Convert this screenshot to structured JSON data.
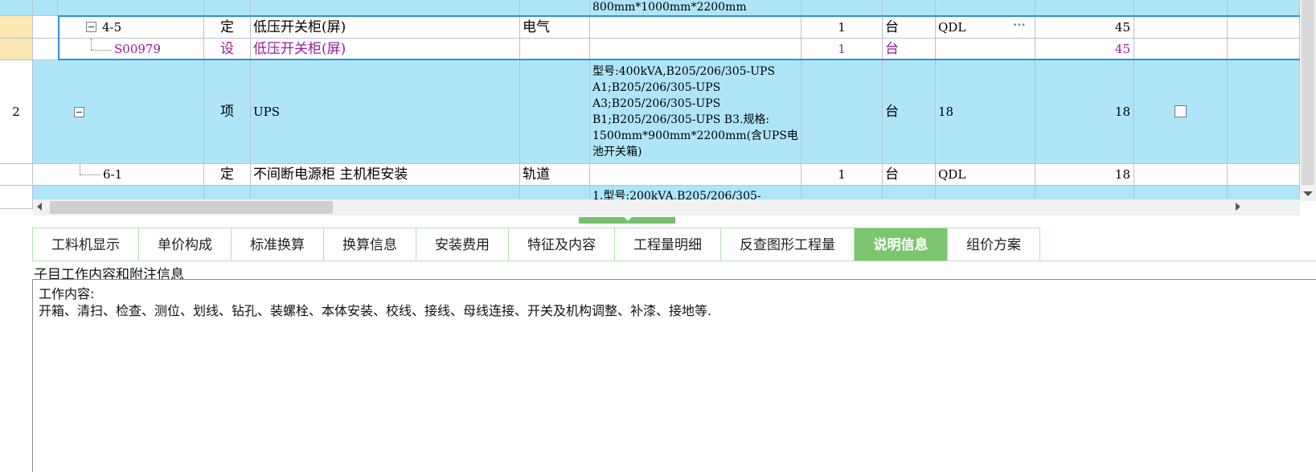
{
  "grid": {
    "row0": {
      "spec": "800mm*1000mm*2200mm"
    },
    "row1": {
      "code": "4-5",
      "type": "定",
      "name": "低压开关柜(屏)",
      "specialty": "电气",
      "qty": "1",
      "unit": "台",
      "calc": "QDL",
      "more": "···",
      "total": "45"
    },
    "row2": {
      "code": "S00979",
      "type": "设",
      "name": "低压开关柜(屏)",
      "qty": "1",
      "unit": "台",
      "total": "45"
    },
    "row3": {
      "rownum": "2",
      "type": "项",
      "name": "UPS",
      "spec_lines": [
        "型号:400kVA,B205/206/305-UPS",
        "A1;B205/206/305-UPS",
        "A3;B205/206/305-UPS",
        "B1;B205/206/305-UPS B3.规格:",
        "1500mm*900mm*2200mm(含UPS电",
        "池开关箱)"
      ],
      "unit": "台",
      "calc": "18",
      "total": "18"
    },
    "row4": {
      "code": "6-1",
      "type": "定",
      "name": "不间断电源柜 主机柜安装",
      "specialty": "轨道",
      "qty": "1",
      "unit": "台",
      "calc": "QDL",
      "total": "18"
    },
    "row5": {
      "spec": "1.型号:200kVA,B205/206/305-"
    }
  },
  "tabs": [
    {
      "label": "工料机显示"
    },
    {
      "label": "单价构成"
    },
    {
      "label": "标准换算"
    },
    {
      "label": "换算信息"
    },
    {
      "label": "安装费用"
    },
    {
      "label": "特征及内容"
    },
    {
      "label": "工程量明细"
    },
    {
      "label": "反查图形工程量"
    },
    {
      "label": "说明信息",
      "active": true
    },
    {
      "label": "组价方案"
    }
  ],
  "panel": {
    "title": "子目工作内容和附注信息",
    "line1": "工作内容:",
    "line2": "开箱、清扫、检查、测位、划线、钻孔、装螺栓、本体安装、校线、接线、母线连接、开关及机构调整、补漆、接地等."
  },
  "colors": {
    "row_blue": "#aee6f7",
    "row_selected_border": "#2f8fd8",
    "tab_active": "#7cc66f",
    "purple_text": "#9b1a9b"
  }
}
